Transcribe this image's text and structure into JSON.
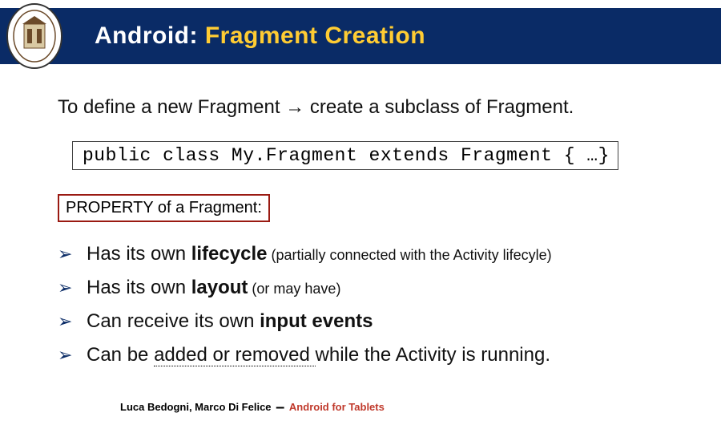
{
  "header": {
    "title_pre": "Android:",
    "title_accent": "Fragment Creation"
  },
  "intro": {
    "pre": "To define a new Fragment ",
    "arrow": "→",
    "post": " create a subclass of Fragment."
  },
  "code": "public class My.Fragment extends Fragment { …}",
  "property_label": "PROPERTY of a Fragment:",
  "bullet_glyph": "➢",
  "bullets": [
    {
      "pre": "Has its own ",
      "bold": "lifecycle",
      "small": " (partially connected with the Activity lifecyle)",
      "post": ""
    },
    {
      "pre": "Has its own ",
      "bold": "layout",
      "small": " (or may have)",
      "post": ""
    },
    {
      "pre": "Can receive its own ",
      "bold": "input events",
      "small": "",
      "post": ""
    },
    {
      "pre": "Can be ",
      "bold": "",
      "dotted": "added or removed ",
      "post": "while the Activity is running."
    }
  ],
  "footer": {
    "authors": "Luca Bedogni, Marco Di Felice",
    "dash": "–",
    "topic": "Android for Tablets"
  }
}
